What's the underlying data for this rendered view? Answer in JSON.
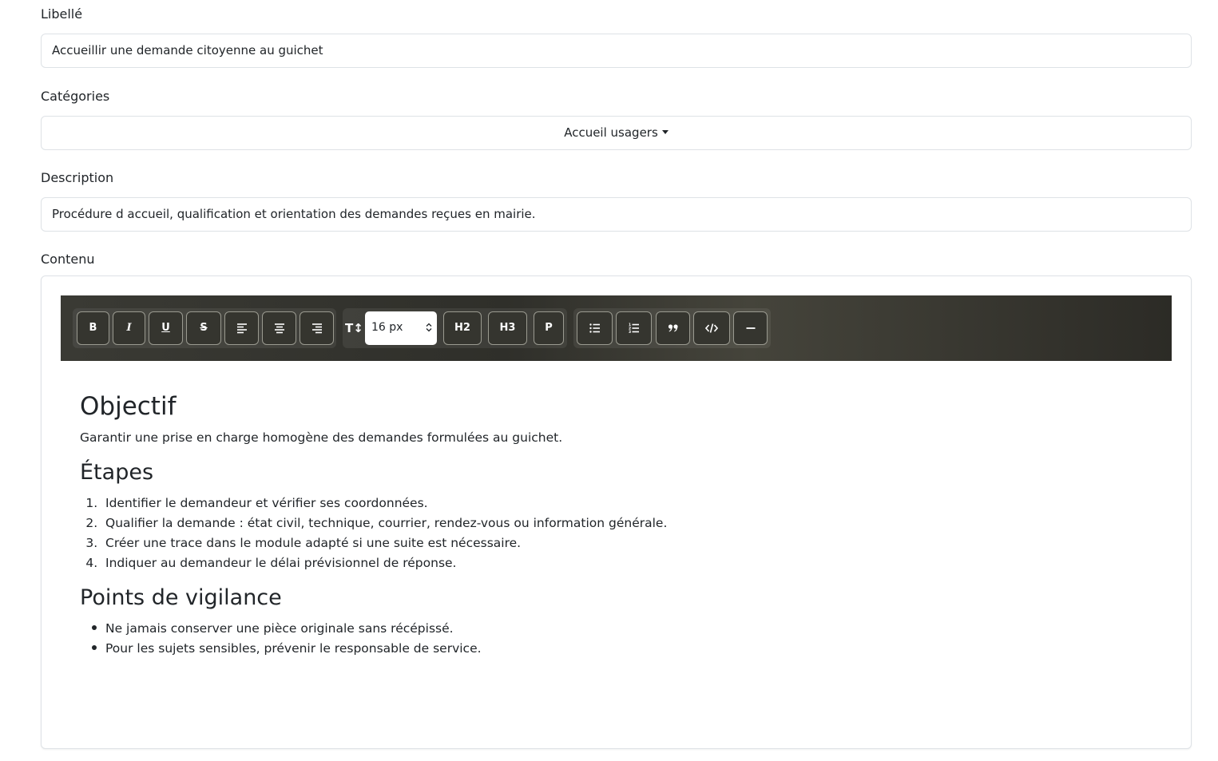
{
  "form": {
    "libelle": {
      "label": "Libellé",
      "value": "Accueillir une demande citoyenne au guichet"
    },
    "categories": {
      "label": "Catégories",
      "value": "Accueil usagers"
    },
    "description": {
      "label": "Description",
      "value": "Procédure d accueil, qualification et orientation des demandes reçues en mairie."
    },
    "contenu": {
      "label": "Contenu"
    }
  },
  "toolbar": {
    "bold": "B",
    "italic": "I",
    "underline": "U",
    "strike": "S",
    "font_size": "16 px",
    "h2": "H2",
    "h3": "H3",
    "p": "P",
    "size_icon": "T↕"
  },
  "content": {
    "heading1": "Objectif",
    "paragraph1": "Garantir une prise en charge homogène des demandes formulées au guichet.",
    "heading2": "Étapes",
    "steps": [
      "Identifier le demandeur et vérifier ses coordonnées.",
      "Qualifier la demande : état civil, technique, courrier, rendez-vous ou information générale.",
      "Créer une trace dans le module adapté si une suite est nécessaire.",
      "Indiquer au demandeur le délai prévisionnel de réponse."
    ],
    "heading3": "Points de vigilance",
    "bullets": [
      "Ne jamais conserver une pièce originale sans récépissé.",
      "Pour les sujets sensibles, prévenir le responsable de service."
    ]
  },
  "colors": {
    "toolbar_bg": "#33332d",
    "border": "#dee2e6",
    "text": "#212529"
  }
}
